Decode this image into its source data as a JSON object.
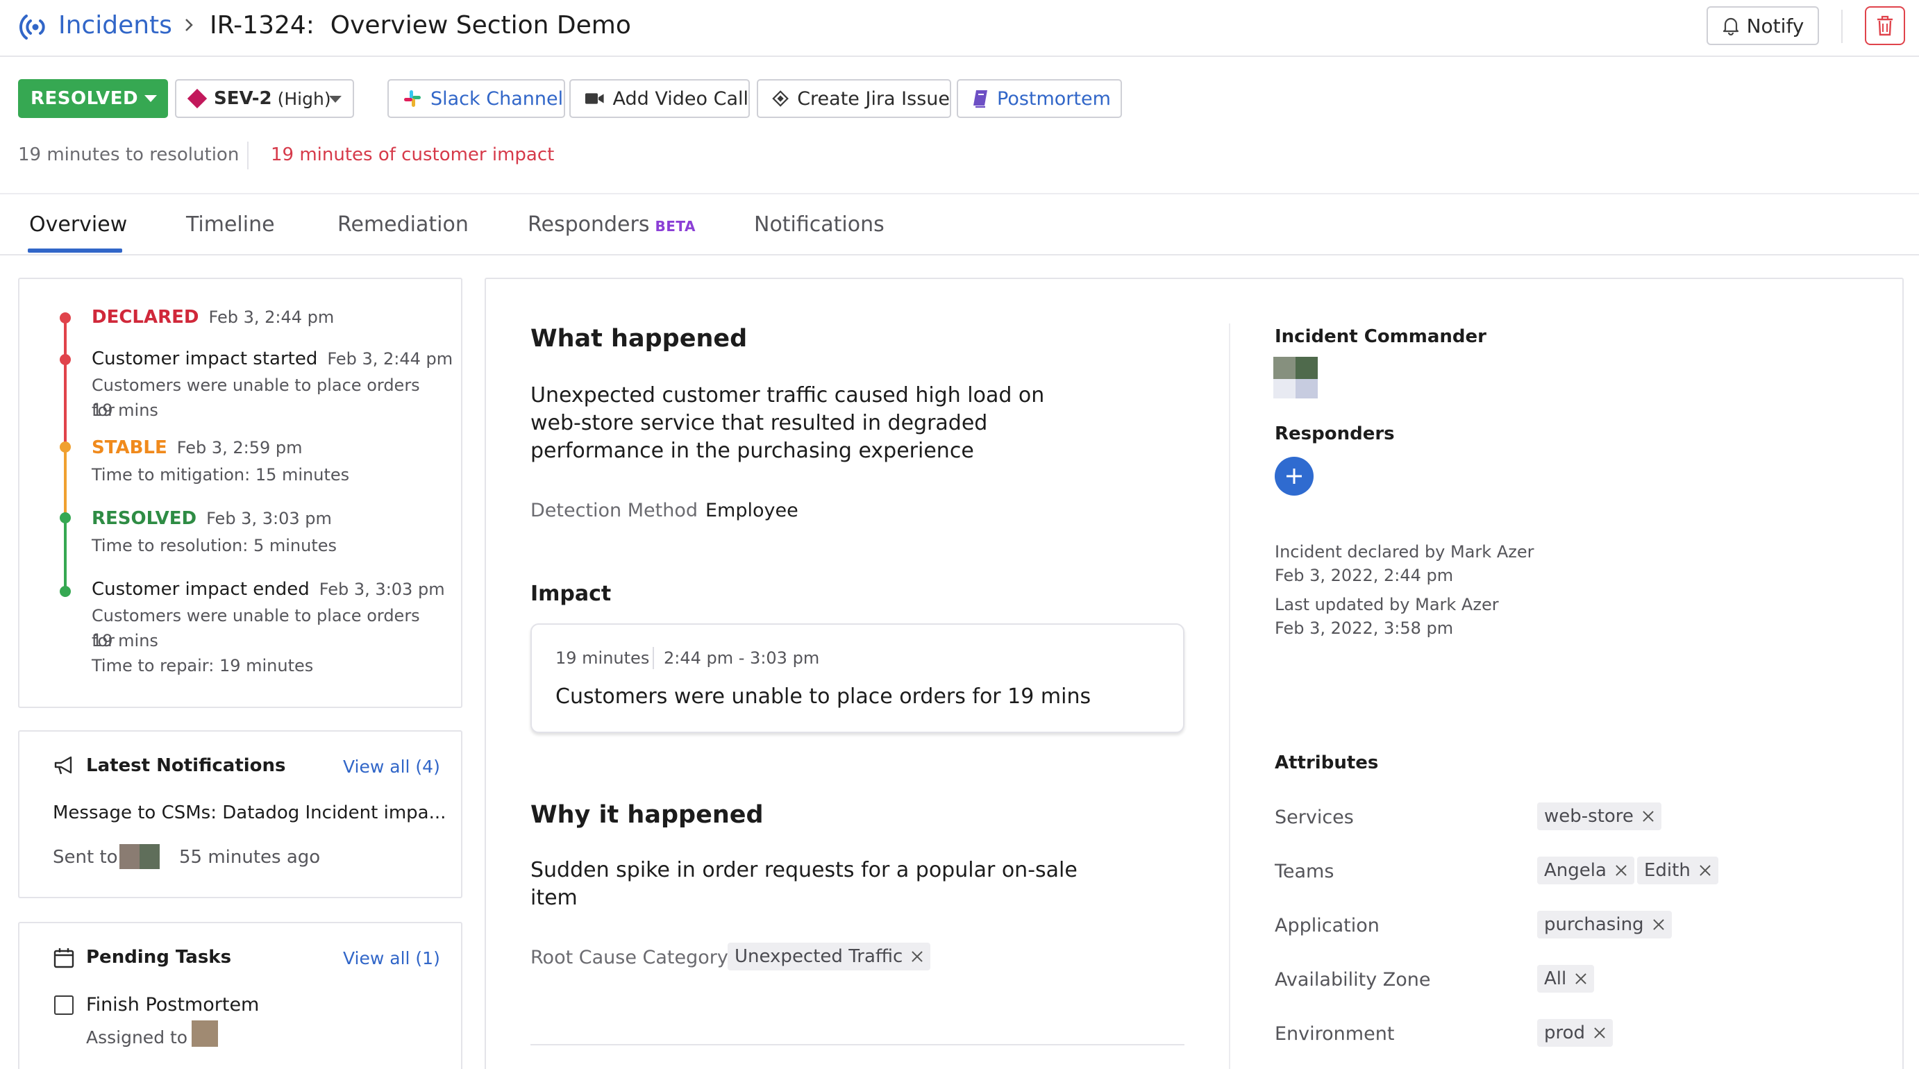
{
  "header": {
    "breadcrumb_root": "Incidents",
    "title": "IR-1324:  Overview Section Demo",
    "notify_label": "Notify"
  },
  "actions": {
    "status": "RESOLVED",
    "severity_name": "SEV-2",
    "severity_level": "(High)",
    "slack": "Slack Channel",
    "video": "Add Video Call",
    "jira": "Create Jira Issue",
    "postmortem": "Postmortem"
  },
  "meta": {
    "resolution": "19 minutes to resolution",
    "impact": "19 minutes of customer impact"
  },
  "tabs": [
    {
      "label": "Overview"
    },
    {
      "label": "Timeline"
    },
    {
      "label": "Remediation"
    },
    {
      "label": "Responders",
      "badge": "BETA"
    },
    {
      "label": "Notifications"
    }
  ],
  "timeline": [
    {
      "label": "DECLARED",
      "date": "Feb 3, 2:44 pm"
    },
    {
      "label": "Customer impact started",
      "date": "Feb 3, 2:44 pm",
      "sub": [
        "Customers were unable to place orders for",
        "19 mins"
      ]
    },
    {
      "label": "STABLE",
      "date": "Feb 3, 2:59 pm",
      "sub": [
        "Time to mitigation: 15 minutes"
      ]
    },
    {
      "label": "RESOLVED",
      "date": "Feb 3, 3:03 pm",
      "sub": [
        "Time to resolution: 5 minutes"
      ]
    },
    {
      "label": "Customer impact ended",
      "date": "Feb 3, 3:03 pm",
      "sub": [
        "Customers were unable to place orders for",
        "19 mins",
        "Time to repair: 19 minutes"
      ]
    }
  ],
  "notifications": {
    "title": "Latest Notifications",
    "view_all": "View all (4)",
    "message": "Message to CSMs: Datadog Incident impa...",
    "sent_to": "Sent to",
    "ago": "55 minutes ago"
  },
  "tasks": {
    "title": "Pending Tasks",
    "view_all": "View all (1)",
    "item": "Finish Postmortem",
    "assigned": "Assigned to"
  },
  "what_happened": {
    "title": "What happened",
    "text": "Unexpected customer traffic caused high load on web-store service that resulted in degraded performance in the purchasing experience",
    "detection_key": "Detection Method",
    "detection_val": "Employee"
  },
  "impact": {
    "title": "Impact",
    "duration": "19 minutes",
    "range": "2:44 pm - 3:03 pm",
    "description": "Customers were unable to place orders for 19 mins"
  },
  "why": {
    "title": "Why it happened",
    "text": "Sudden spike in order requests for a popular on-sale item",
    "root_key": "Root Cause Category",
    "root_tag": "Unexpected Traffic"
  },
  "side": {
    "commander_title": "Incident Commander",
    "responders_title": "Responders",
    "declared_by": "Incident declared by Mark Azer",
    "declared_at": "Feb 3, 2022, 2:44 pm",
    "updated_by": "Last updated by Mark Azer",
    "updated_at": "Feb 3, 2022, 3:58 pm",
    "attributes_title": "Attributes"
  },
  "attributes": {
    "services_key": "Services",
    "services": [
      "web-store"
    ],
    "teams_key": "Teams",
    "teams": [
      "Angela",
      "Edith"
    ],
    "application_key": "Application",
    "application": [
      "purchasing"
    ],
    "az_key": "Availability Zone",
    "az": [
      "All"
    ],
    "env_key": "Environment",
    "env": [
      "prod"
    ]
  },
  "colors": {
    "brand_blue": "#3166c8",
    "resolved_green": "#36a852",
    "declared_red": "#d0283a",
    "stable_orange": "#f08a1c",
    "sev_magenta": "#c2185b",
    "beta_purple": "#8b3fd6"
  }
}
